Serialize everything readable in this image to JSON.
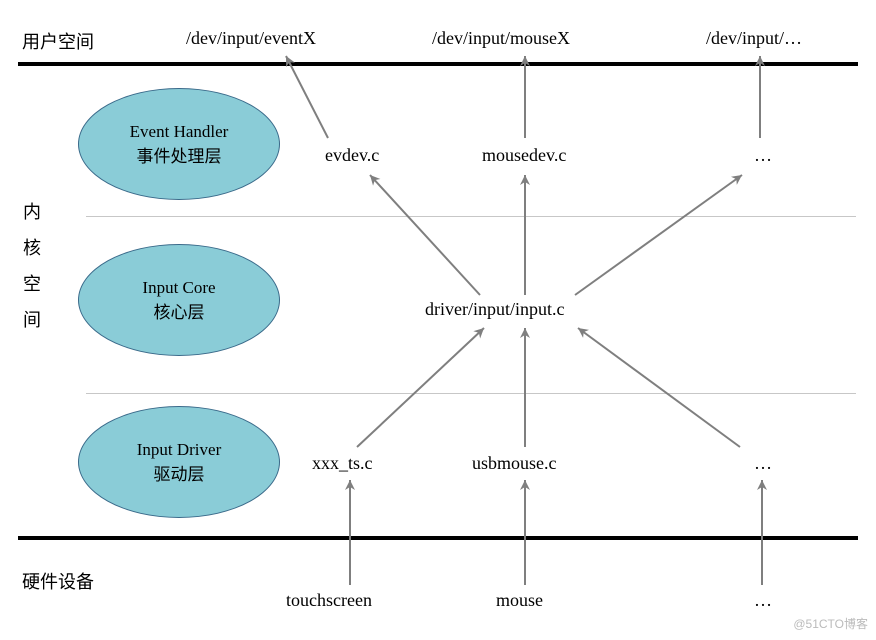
{
  "labels": {
    "user_space": "用户空间",
    "kernel_space_vertical": "内\n核\n空\n间",
    "hardware": "硬件设备",
    "dev_eventx": "/dev/input/eventX",
    "dev_mousex": "/dev/input/mouseX",
    "dev_more": "/dev/input/…",
    "evdev": "evdev.c",
    "mousedev": "mousedev.c",
    "handler_more": "…",
    "input_c": "driver/input/input.c",
    "xxx_ts": "xxx_ts.c",
    "usbmouse": "usbmouse.c",
    "driver_more": "…",
    "touchscreen": "touchscreen",
    "mouse": "mouse",
    "hw_more": "…"
  },
  "ellipses": {
    "event_handler_en": "Event Handler",
    "event_handler_zh": "事件处理层",
    "input_core_en": "Input Core",
    "input_core_zh": "核心层",
    "input_driver_en": "Input Driver",
    "input_driver_zh": "驱动层"
  },
  "watermark": "@51CTO博客",
  "chart_data": {
    "type": "diagram",
    "title": "Linux Input Subsystem Architecture",
    "layers": [
      {
        "name": "用户空间",
        "items": [
          "/dev/input/eventX",
          "/dev/input/mouseX",
          "/dev/input/…"
        ]
      },
      {
        "name": "Event Handler 事件处理层",
        "items": [
          "evdev.c",
          "mousedev.c",
          "…"
        ]
      },
      {
        "name": "Input Core 核心层",
        "items": [
          "driver/input/input.c"
        ]
      },
      {
        "name": "Input Driver 驱动层",
        "items": [
          "xxx_ts.c",
          "usbmouse.c",
          "…"
        ]
      },
      {
        "name": "硬件设备",
        "items": [
          "touchscreen",
          "mouse",
          "…"
        ]
      }
    ],
    "edges": [
      [
        "touchscreen",
        "xxx_ts.c"
      ],
      [
        "mouse",
        "usbmouse.c"
      ],
      [
        "…_hw",
        "…_driver"
      ],
      [
        "xxx_ts.c",
        "driver/input/input.c"
      ],
      [
        "usbmouse.c",
        "driver/input/input.c"
      ],
      [
        "…_driver",
        "driver/input/input.c"
      ],
      [
        "driver/input/input.c",
        "evdev.c"
      ],
      [
        "driver/input/input.c",
        "mousedev.c"
      ],
      [
        "driver/input/input.c",
        "…_handler"
      ],
      [
        "evdev.c",
        "/dev/input/eventX"
      ],
      [
        "mousedev.c",
        "/dev/input/mouseX"
      ],
      [
        "…_handler",
        "/dev/input/…"
      ]
    ]
  }
}
